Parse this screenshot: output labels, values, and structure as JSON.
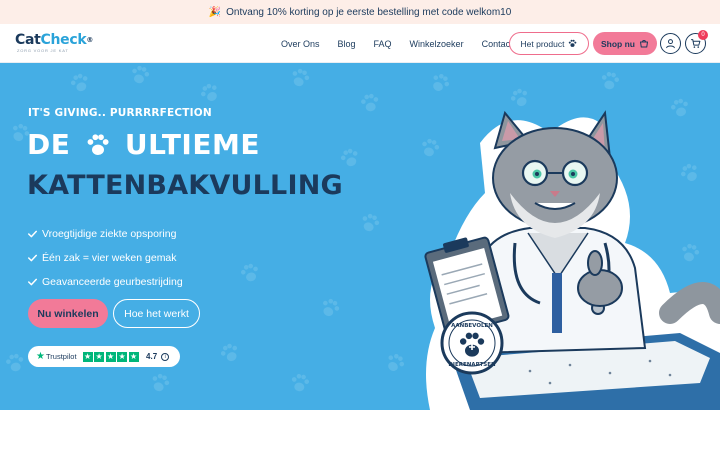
{
  "announcement": {
    "icon": "party-popper-icon",
    "text": "Ontvang 10% korting op je eerste bestelling met code welkom10"
  },
  "brand": {
    "name_part1": "Cat",
    "name_part2": "Check",
    "tagline": "ZORG VOOR JE KAT"
  },
  "nav": {
    "links": [
      "Over Ons",
      "Blog",
      "FAQ",
      "Winkelzoeker",
      "Contact"
    ],
    "product_button": "Het product",
    "shop_button": "Shop nu",
    "cart_count": "0"
  },
  "hero": {
    "eyebrow": "IT'S GIVING.. PURRRRFECTION",
    "title_line1_a": "DE",
    "title_line1_b": "ULTIEME",
    "title_line2": "KATTENBAKVULLING",
    "bullets": [
      "Vroegtijdige ziekte opsporing",
      "Één zak = vier weken gemak",
      "Geavanceerde geurbestrijding"
    ],
    "primary_cta": "Nu winkelen",
    "secondary_cta": "Hoe het werkt",
    "trustpilot": {
      "label": "Trustpilot",
      "stars": 5,
      "rating": "4.7"
    },
    "badge_text_top": "AANBEVOLEN",
    "badge_text_bottom": "DIERENARTSEN",
    "clipboard_brand": "CatCheck"
  },
  "colors": {
    "hero_bg": "#45aee5",
    "accent_pink": "#f27a98",
    "navy": "#1b3a5c",
    "trustpilot_green": "#00b67a"
  }
}
